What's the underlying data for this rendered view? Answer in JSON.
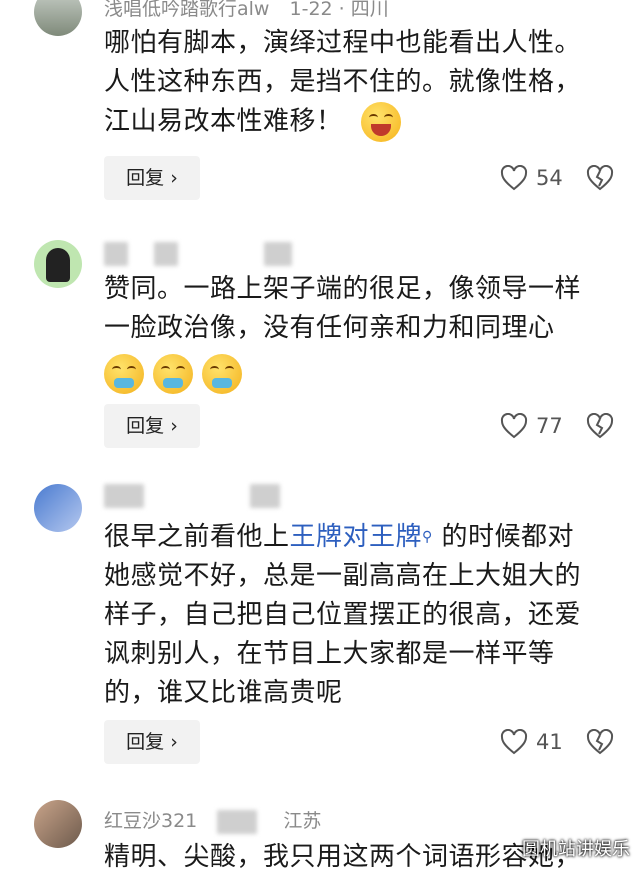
{
  "comments": [
    {
      "username": "浅唱低吟踏歌行alw",
      "meta": "1-22 · 四川",
      "lines": [
        "哪怕有脚本，演绎过程中也能看出人性。",
        "人性这种东西，是挡不住的。就像性格，",
        "江山易改本性难移！"
      ],
      "reply_label": "回复 ›",
      "like_count": "54",
      "emoji": "squinting-face-with-tongue"
    },
    {
      "username": "",
      "lines": [
        "赞同。一路上架子端的很足，像领导一样",
        "一脸政治像，没有任何亲和力和同理心"
      ],
      "reply_label": "回复 ›",
      "like_count": "77",
      "emoji": "vomiting-face x3"
    },
    {
      "username": "",
      "text_before_link": "很早之前看他上",
      "link_text": "王牌对王牌",
      "text_after_link": " 的时候都对",
      "lines": [
        "她感觉不好，总是一副高高在上大姐大的",
        "样子，自己把自己位置摆正的很高，还爱",
        "讽刺别人，在节目上大家都是一样平等",
        "的，谁又比谁高贵呢"
      ],
      "reply_label": "回复 ›",
      "like_count": "41"
    },
    {
      "username": "红豆沙321",
      "meta": "江苏",
      "lines": [
        "精明、尖酸，我只用这两个词语形容她，"
      ]
    }
  ],
  "watermark": "圆机站讲娱乐",
  "colors": {
    "link": "#2d5fbf",
    "reply_bg": "#f2f2f2",
    "meta": "#8a8a8a"
  }
}
